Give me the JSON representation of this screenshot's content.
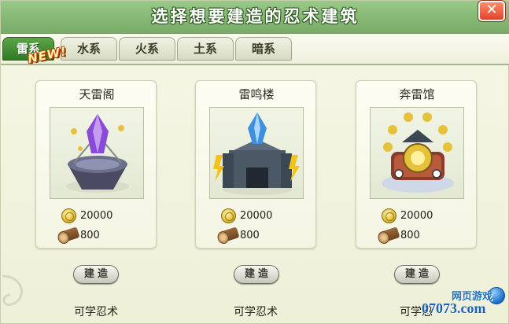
{
  "dialog": {
    "title": "选择想要建造的忍术建筑",
    "close_label": "✕"
  },
  "tabs": [
    {
      "label": "雷系",
      "active": true
    },
    {
      "label": "水系",
      "active": false
    },
    {
      "label": "火系",
      "active": false
    },
    {
      "label": "土系",
      "active": false
    },
    {
      "label": "暗系",
      "active": false
    }
  ],
  "new_badge": "NEW!",
  "buildings": [
    {
      "name": "天雷阁",
      "icon": "crystal-pavilion-icon",
      "coin_cost": "20000",
      "wood_cost": "800",
      "build_label": "建造",
      "learn_label": "可学忍术"
    },
    {
      "name": "雷鸣楼",
      "icon": "thunder-tower-icon",
      "coin_cost": "20000",
      "wood_cost": "800",
      "build_label": "建造",
      "learn_label": "可学忍术"
    },
    {
      "name": "奔雷馆",
      "icon": "thunder-hall-icon",
      "coin_cost": "20000",
      "wood_cost": "800",
      "build_label": "建造",
      "learn_label": "可学忍"
    }
  ],
  "watermark": {
    "line1": "网页游戏",
    "line2": "07073.com"
  },
  "colors": {
    "title_bar": "#86b873",
    "active_tab": "#2f7a22",
    "panel_bg": "#f3f4e2"
  }
}
